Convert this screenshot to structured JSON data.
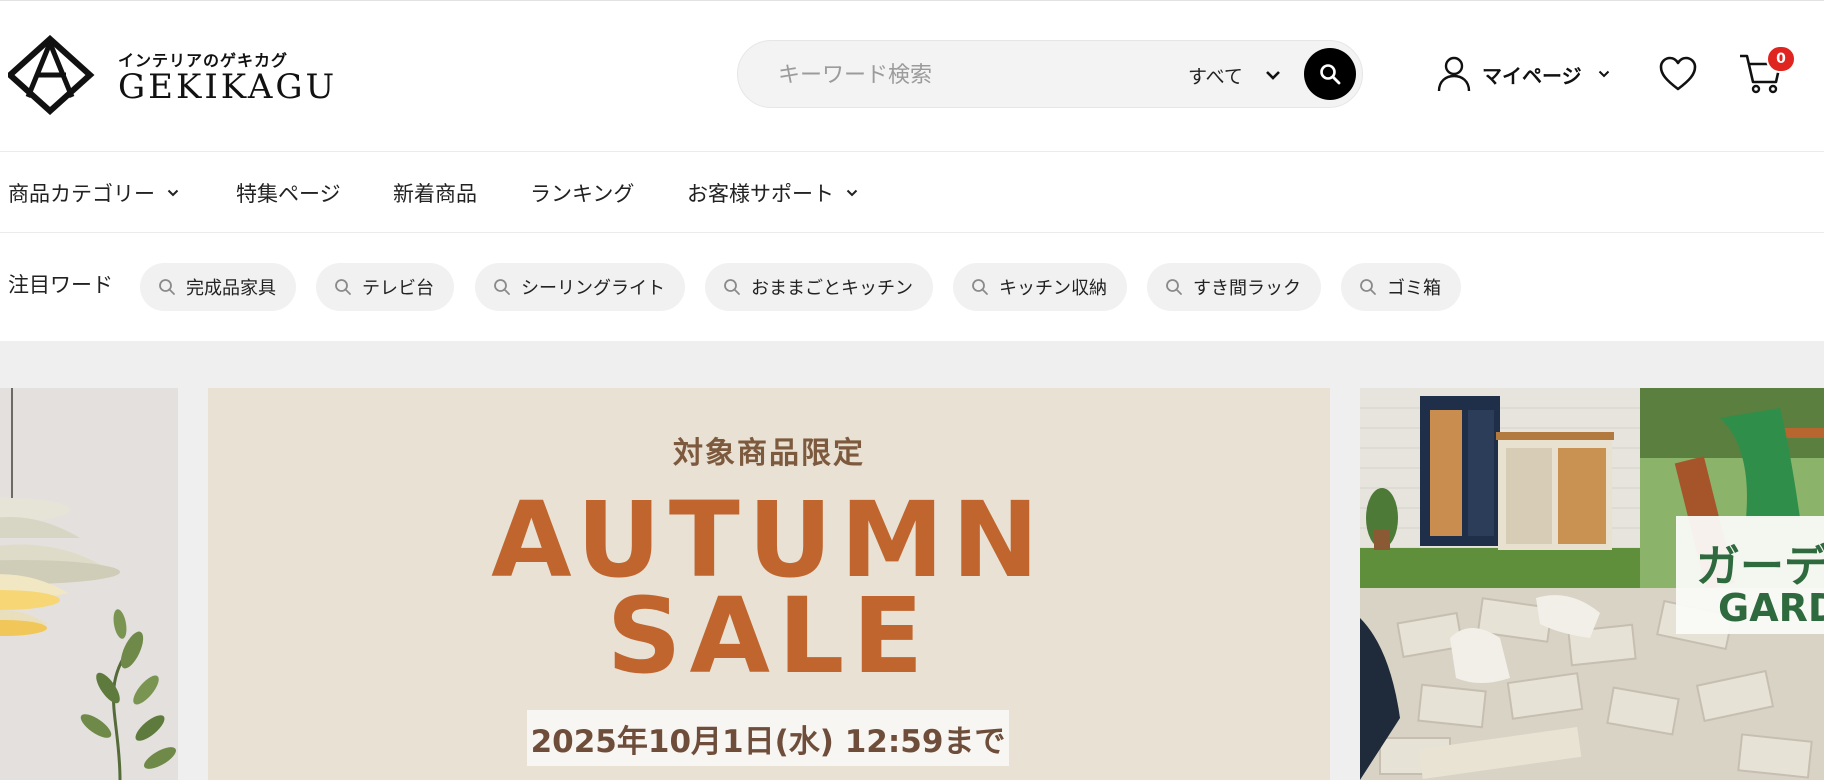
{
  "header": {
    "logo": {
      "subtitle": "インテリアのゲキカグ",
      "name": "GEKIKAGU"
    },
    "search": {
      "placeholder": "キーワード検索",
      "value": "",
      "scope": "すべて"
    },
    "account": {
      "label": "マイページ"
    },
    "cart": {
      "count": "0"
    }
  },
  "nav": {
    "items": [
      {
        "label": "商品カテゴリー",
        "has_dropdown": true
      },
      {
        "label": "特集ページ",
        "has_dropdown": false
      },
      {
        "label": "新着商品",
        "has_dropdown": false
      },
      {
        "label": "ランキング",
        "has_dropdown": false
      },
      {
        "label": "お客様サポート",
        "has_dropdown": true
      }
    ]
  },
  "hot_words": {
    "title": "注目ワード",
    "items": [
      "完成品家具",
      "テレビ台",
      "シーリングライト",
      "おままごとキッチン",
      "キッチン収納",
      "すき間ラック",
      "ゴミ箱"
    ]
  },
  "banner": {
    "main": {
      "subtitle": "対象商品限定",
      "title_line1": "AUTUMN",
      "title_line2": "SALE",
      "deadline": "2025年10月1日(水) 12:59まで"
    },
    "right": {
      "title_ja": "ガーデ",
      "title_en": "GARD"
    }
  },
  "colors": {
    "accent_badge": "#e0241f",
    "promo_text": "#c0652e",
    "promo_bg": "#e8e1d4",
    "garden_green": "#2f6a3e"
  },
  "icons": [
    "logo-mark-icon",
    "search-icon",
    "chevron-down-icon",
    "user-icon",
    "heart-icon",
    "cart-icon"
  ]
}
